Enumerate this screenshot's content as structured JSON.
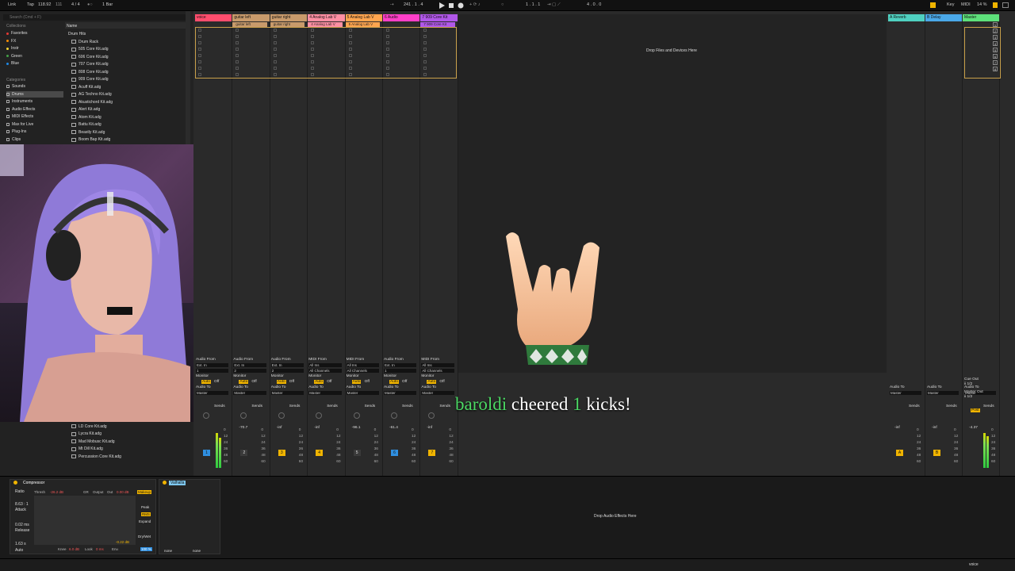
{
  "topbar": {
    "link": "Link",
    "tap": "Tap",
    "tempo": "118.92",
    "bars": "111",
    "signature": "4 / 4",
    "quantize": "1 Bar",
    "position": "241 . 1 . 4",
    "loop_start": "1 . 1 . 1",
    "loop_length": "4 . 0 . 0",
    "key_label": "Key",
    "midi_label": "MIDI",
    "cpu": "14 %"
  },
  "browser": {
    "search_placeholder": "Search (Cmd + F)",
    "collections_title": "Collections",
    "collections": [
      {
        "label": "Favorites",
        "color": "#e53935"
      },
      {
        "label": "FX",
        "color": "#fb8c00"
      },
      {
        "label": "Instr",
        "color": "#fdd835"
      },
      {
        "label": "Green",
        "color": "#43a047"
      },
      {
        "label": "Blue",
        "color": "#1e88e5"
      }
    ],
    "categories_title": "Categories",
    "categories": [
      "Sounds",
      "Drums",
      "Instruments",
      "Audio Effects",
      "MIDI Effects",
      "Max for Live",
      "Plug-Ins",
      "Clips"
    ],
    "name_header": "Name",
    "folder": "Drum Hits",
    "files": [
      "Drum Rack",
      "505 Core Kit.adg",
      "606 Core Kit.adg",
      "707 Core Kit.adg",
      "808 Core Kit.adg",
      "909 Core Kit.adg",
      "Acuff Kit.adg",
      "AG Techno Kit.adg",
      "Akustichord Kit.adg",
      "Alert Kit.adg",
      "Atom Kit.adg",
      "Battu Kit.adg",
      "Beastly Kit.adg",
      "Boom Bap Kit.adg"
    ],
    "files_lower": [
      "LD Core Kit.adg",
      "Lycra Kit.adg",
      "Mad Mobusc Kit.adg",
      "Mt Dill Kit.adg",
      "Percussion Core Kit.adg"
    ]
  },
  "tracks": [
    {
      "name": "voice",
      "color": "#ff4d6d",
      "clip": "",
      "io_type": "Audio From",
      "input": "Ext. In",
      "chan": "1",
      "num": "1",
      "vol": "",
      "btn_color": "#2f8fe0"
    },
    {
      "name": "guitar left",
      "color": "#c89a6b",
      "clip": "guitar left",
      "io_type": "Audio From",
      "input": "Ext. In",
      "chan": "2",
      "num": "2",
      "vol": "-70.7",
      "btn_color": "#3a3a3a"
    },
    {
      "name": "guitar right",
      "color": "#c89a6b",
      "clip": "guitar right",
      "io_type": "Audio From",
      "input": "Ext. In",
      "chan": "2",
      "num": "3",
      "vol": "-inf",
      "btn_color": "#f0b400"
    },
    {
      "name": "4 Analog Lab V",
      "color": "#ff8fa3",
      "clip": "4 Analog Lab V",
      "io_type": "MIDI From",
      "input": "All Ins",
      "chan": "All Channels",
      "num": "4",
      "vol": "-inf",
      "btn_color": "#f0b400"
    },
    {
      "name": "5 Analog Lab V",
      "color": "#ffa54f",
      "clip": "5 Analog Lab V",
      "io_type": "MIDI From",
      "input": "All Ins",
      "chan": "All Channels",
      "num": "5",
      "vol": "-96.1",
      "btn_color": "#3a3a3a"
    },
    {
      "name": "6 Audio",
      "color": "#ff3fc8",
      "clip": "",
      "io_type": "Audio From",
      "input": "Ext. In",
      "chan": "1",
      "num": "6",
      "vol": "-61.4",
      "btn_color": "#2f8fe0"
    },
    {
      "name": "7 909 Core Kit",
      "color": "#b057e8",
      "clip": "7 909 Core Kit",
      "io_type": "MIDI From",
      "input": "All Ins",
      "chan": "All Channels",
      "num": "7",
      "vol": "-inf",
      "btn_color": "#f0b400"
    }
  ],
  "returns": [
    {
      "name": "A Reverb",
      "color": "#4fd0c0",
      "letter": "A",
      "vol": "-inf"
    },
    {
      "name": "B Delay",
      "color": "#4aa8e8",
      "letter": "B",
      "vol": "-inf"
    },
    {
      "name": "Master",
      "color": "#5de07a",
      "letter": "",
      "vol": "-4.37"
    }
  ],
  "io_labels": {
    "monitor": "Monitor",
    "in": "In",
    "auto": "Auto",
    "off": "Off",
    "audio_to": "Audio To",
    "master": "Master",
    "sends": "Sends",
    "cue_out": "Cue Out",
    "cue_val": "ii 1/2",
    "master_out": "Master Out",
    "master_val": "ii 1/2",
    "post": "Post"
  },
  "drop_files": "Drop Files and Devices Here",
  "drop_effects": "Drop Audio Effects Here",
  "alert": {
    "user": "baroldi",
    "verb": "cheered",
    "amount": "1",
    "unit": "kicks!"
  },
  "device": {
    "name": "Compressor",
    "ratio_label": "Ratio",
    "ratio": "8.63 : 1",
    "attack_label": "Attack",
    "attack": "0.02 ms",
    "release_label": "Release",
    "release": "1.63 s",
    "auto": "Auto",
    "thresh": "Thresh",
    "thresh_val": "-26.2 dB",
    "gr": "GR",
    "output": "Output",
    "out": "Out",
    "out_val": "0.00 dB",
    "makeup": "Makeup",
    "peak": "Peak",
    "rms": "RMS",
    "expand": "Expand",
    "knee": "Knee",
    "knee_val": "6.0 dB",
    "look": "Look",
    "look_val": "0 ms",
    "env": "Env.",
    "gain": "-0.22 dB",
    "drywet": "Dry/Wet",
    "drywet_val": "100 %",
    "plugin": "Valhalla",
    "none1": "none",
    "none2": "none"
  },
  "status": {
    "track": "voice"
  },
  "colors": {
    "accent": "#f0b400",
    "alert_green": "#4cd964"
  },
  "icons": [
    "play-icon",
    "stop-icon",
    "record-icon",
    "metronome-icon",
    "folder-icon",
    "rock-hand-emoji"
  ]
}
